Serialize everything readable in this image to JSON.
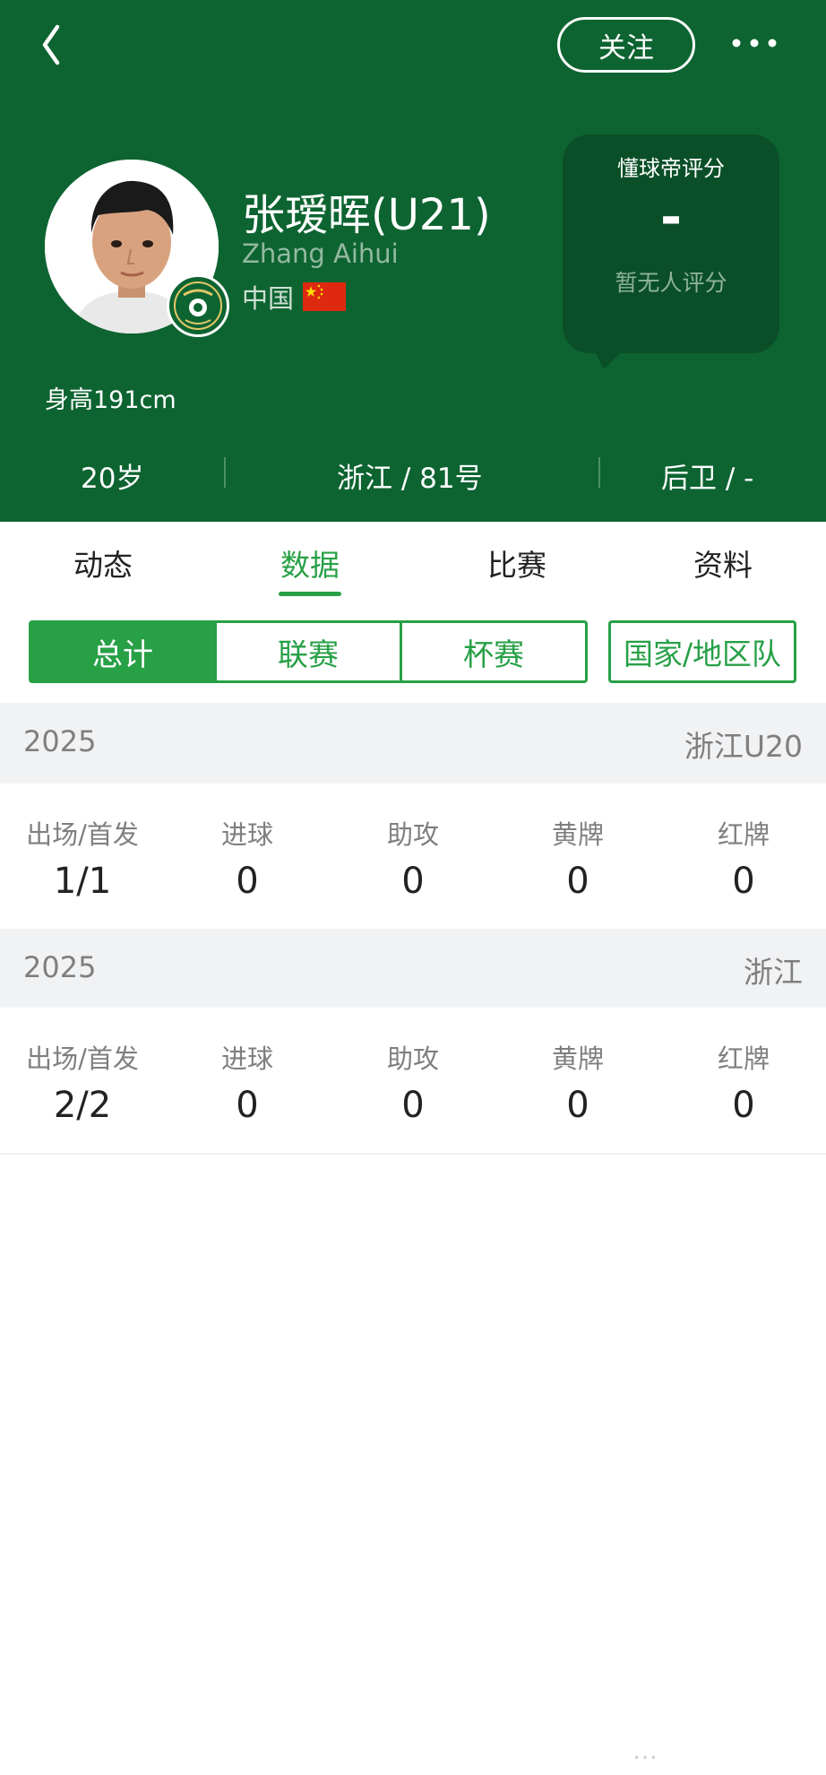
{
  "header": {
    "follow_label": "关注",
    "bg_color": "#0d6431",
    "back_icon": "chevron-left-icon",
    "more_icon": "ellipsis-icon"
  },
  "player": {
    "name": "张瑷晖(U21)",
    "name_latin": "Zhang Aihui",
    "country": "中国",
    "height": "身高191cm"
  },
  "rating": {
    "title": "懂球帝评分",
    "value": "-",
    "note": "暂无人评分"
  },
  "info": {
    "age": "20岁",
    "team_number": "浙江 / 81号",
    "position": "后卫 / -"
  },
  "tabs": [
    {
      "label": "动态"
    },
    {
      "label": "数据"
    },
    {
      "label": "比赛"
    },
    {
      "label": "资料"
    }
  ],
  "active_tab": "数据",
  "segments": [
    {
      "label": "总计"
    },
    {
      "label": "联赛"
    },
    {
      "label": "杯赛"
    },
    {
      "label": "国家/地区队"
    }
  ],
  "accent_color": "#27a046",
  "sections": [
    {
      "season": "2025",
      "team": "浙江U20",
      "stats": [
        {
          "label": "出场/首发",
          "value": "1/1"
        },
        {
          "label": "进球",
          "value": "0"
        },
        {
          "label": "助攻",
          "value": "0"
        },
        {
          "label": "黄牌",
          "value": "0"
        },
        {
          "label": "红牌",
          "value": "0"
        }
      ]
    },
    {
      "season": "2025",
      "team": "浙江",
      "stats": [
        {
          "label": "出场/首发",
          "value": "2/2"
        },
        {
          "label": "进球",
          "value": "0"
        },
        {
          "label": "助攻",
          "value": "0"
        },
        {
          "label": "黄牌",
          "value": "0"
        },
        {
          "label": "红牌",
          "value": "0"
        }
      ]
    }
  ],
  "bottom_mark": "…"
}
